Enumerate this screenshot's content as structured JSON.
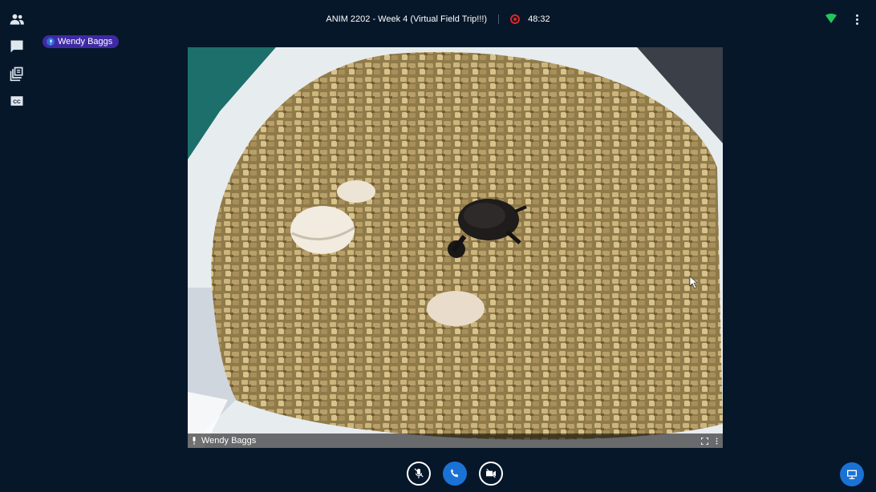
{
  "header": {
    "meeting_title": "ANIM 2202 - Week 4 (Virtual Field Trip!!!)",
    "recording_time": "48:32"
  },
  "sidebar": {
    "items": [
      {
        "name": "users",
        "icon": "users-icon"
      },
      {
        "name": "chat",
        "icon": "chat-icon"
      },
      {
        "name": "notes",
        "icon": "notes-icon"
      },
      {
        "name": "captions",
        "icon": "closed-captions-icon"
      }
    ]
  },
  "talking_indicator": {
    "name": "Wendy Baggs"
  },
  "video": {
    "participant_name": "Wendy Baggs"
  },
  "controls": {
    "mute": {
      "icon": "microphone-muted-icon"
    },
    "audio": {
      "icon": "phone-icon"
    },
    "camera": {
      "icon": "camera-off-icon"
    },
    "presentation": {
      "icon": "presentation-icon"
    }
  },
  "colors": {
    "background": "#06172a",
    "accent_blue": "#1b72d5",
    "recording_red": "#e02424",
    "connection_green": "#22c55e",
    "talker_purple": "#3f2aa6"
  }
}
